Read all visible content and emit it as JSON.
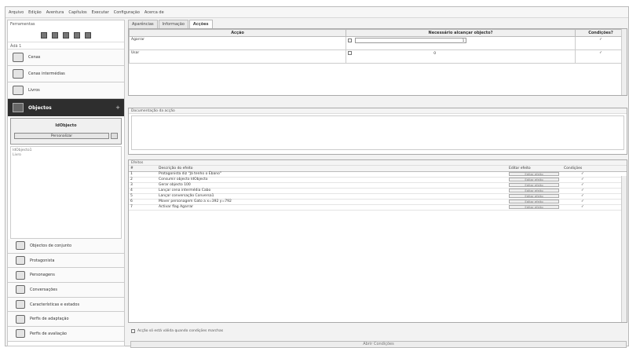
{
  "menu": [
    "Arquivo",
    "Edição",
    "Aventura",
    "Capítulos",
    "Executar",
    "Configuração",
    "Acerca de"
  ],
  "sidebar": {
    "header": "Ferramentas",
    "chapter_field": "Ádã 1",
    "nav_top": [
      {
        "label": "Cenas",
        "icon": "scene-icon"
      },
      {
        "label": "Cenas intermédias",
        "icon": "cutscene-icon"
      },
      {
        "label": "Livros",
        "icon": "book-icon"
      }
    ],
    "objects": {
      "title": "Objectos",
      "plus": "+",
      "object_name": "IdObjecto",
      "button": "Personalizar"
    },
    "ids": [
      "IdObjecto1",
      "Livro"
    ],
    "nav_bottom": [
      {
        "label": "Objectos de conjunto",
        "icon": "set-objects-icon"
      },
      {
        "label": "Protagonista",
        "icon": "player-icon"
      },
      {
        "label": "Personagens",
        "icon": "characters-icon"
      },
      {
        "label": "Conversações",
        "icon": "conversation-icon"
      },
      {
        "label": "Características e estados",
        "icon": "flags-icon"
      },
      {
        "label": "Perfis de adaptação",
        "icon": "adaptation-icon"
      },
      {
        "label": "Perfis de avaliação",
        "icon": "assessment-icon"
      }
    ]
  },
  "main": {
    "tabs": [
      "Aparências",
      "Informação",
      "Acções"
    ],
    "active_tab": 2,
    "actions_table": {
      "headers": [
        "Acção",
        "Necessário alcançar objecto?",
        "Condições?"
      ],
      "rows": [
        {
          "action": "Agarrar",
          "needs": "",
          "combo": "1",
          "cond": "✓"
        },
        {
          "action": "Usar",
          "needs": "",
          "combo": "0",
          "cond": "✓"
        }
      ]
    },
    "doc_caption": "Documentação da acção",
    "effects": {
      "caption": "Efeitos",
      "headers": [
        "#",
        "Descrição do efeito",
        "Editar efeito",
        "Condições"
      ],
      "rows": [
        {
          "n": "1",
          "desc": "Protagonista diz \"Já tenho o Ébano\"",
          "edit": "Editar efeito",
          "cond": "✓"
        },
        {
          "n": "2",
          "desc": "Consumir objecto IdObjecto",
          "edit": "Editar efeito",
          "cond": "✓"
        },
        {
          "n": "3",
          "desc": "Gerar objecto 100",
          "edit": "Editar efeito",
          "cond": "✓"
        },
        {
          "n": "4",
          "desc": "Lançar cena intermédia Cabo",
          "edit": "Editar efeito",
          "cond": "✓"
        },
        {
          "n": "5",
          "desc": "Lançar conversação Conversa1",
          "edit": "Editar efeito",
          "cond": "✓"
        },
        {
          "n": "6",
          "desc": "Mover personagem Gato a x=392 y=792",
          "edit": "Editar efeito",
          "cond": "✓"
        },
        {
          "n": "7",
          "desc": "Activar flag Agarrar",
          "edit": "Editar efeito",
          "cond": "✓"
        }
      ]
    },
    "checkbox_label": "Acção só está válida quando condições marchas",
    "bottom_button": "Abrir Condições"
  }
}
